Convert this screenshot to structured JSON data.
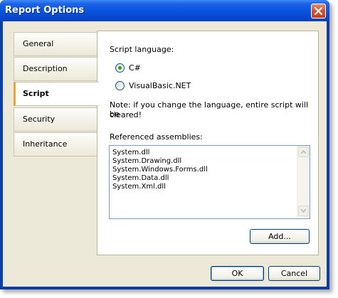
{
  "window": {
    "title": "Report Options",
    "close_glyph": "close-icon"
  },
  "tabs": [
    {
      "label": "General",
      "active": false
    },
    {
      "label": "Description",
      "active": false
    },
    {
      "label": "Script",
      "active": true
    },
    {
      "label": "Security",
      "active": false
    },
    {
      "label": "Inheritance",
      "active": false
    }
  ],
  "script": {
    "language_label": "Script language:",
    "options": [
      {
        "label": "C#",
        "selected": true
      },
      {
        "label": "VisualBasic.NET",
        "selected": false
      }
    ],
    "note_line1": "Note: if you change the language, entire script will be",
    "note_line2": "cleared!",
    "assemblies_label": "Referenced assemblies:",
    "assemblies": [
      "System.dll",
      "System.Drawing.dll",
      "System.Windows.Forms.dll",
      "System.Data.dll",
      "System.Xml.dll"
    ],
    "add_button": "Add..."
  },
  "footer": {
    "ok": "OK",
    "cancel": "Cancel"
  },
  "colors": {
    "titlebar": "#0a55e0",
    "dialog_bg": "#ece9d8",
    "active_tab_marker": "#e8a33a",
    "radio_dot": "#21a121"
  }
}
